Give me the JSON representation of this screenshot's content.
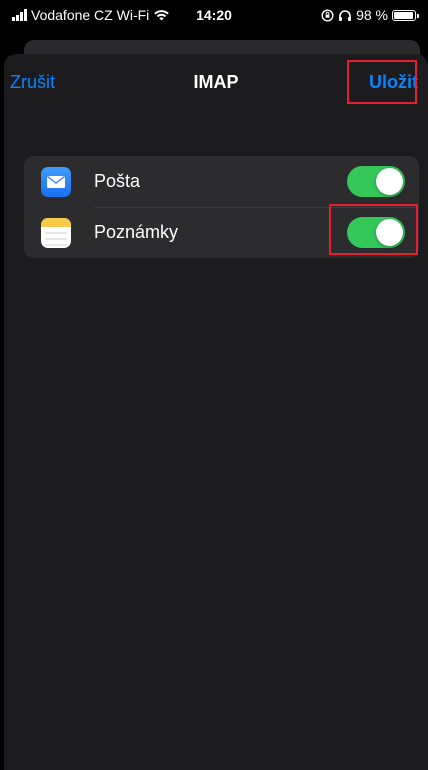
{
  "status_bar": {
    "carrier": "Vodafone CZ Wi-Fi",
    "time": "14:20",
    "battery_percent": "98 %",
    "battery_level": 0.98
  },
  "nav": {
    "cancel_label": "Zrušit",
    "title": "IMAP",
    "save_label": "Uložit"
  },
  "settings": {
    "rows": [
      {
        "label": "Pošta",
        "icon": "mail-app-icon",
        "enabled": true
      },
      {
        "label": "Poznámky",
        "icon": "notes-app-icon",
        "enabled": true
      }
    ]
  },
  "colors": {
    "accent": "#0a84ff",
    "toggle_on": "#34c759",
    "annotation": "#e4202c",
    "sheet_bg": "#1c1c1e",
    "group_bg": "#2c2c2e"
  }
}
